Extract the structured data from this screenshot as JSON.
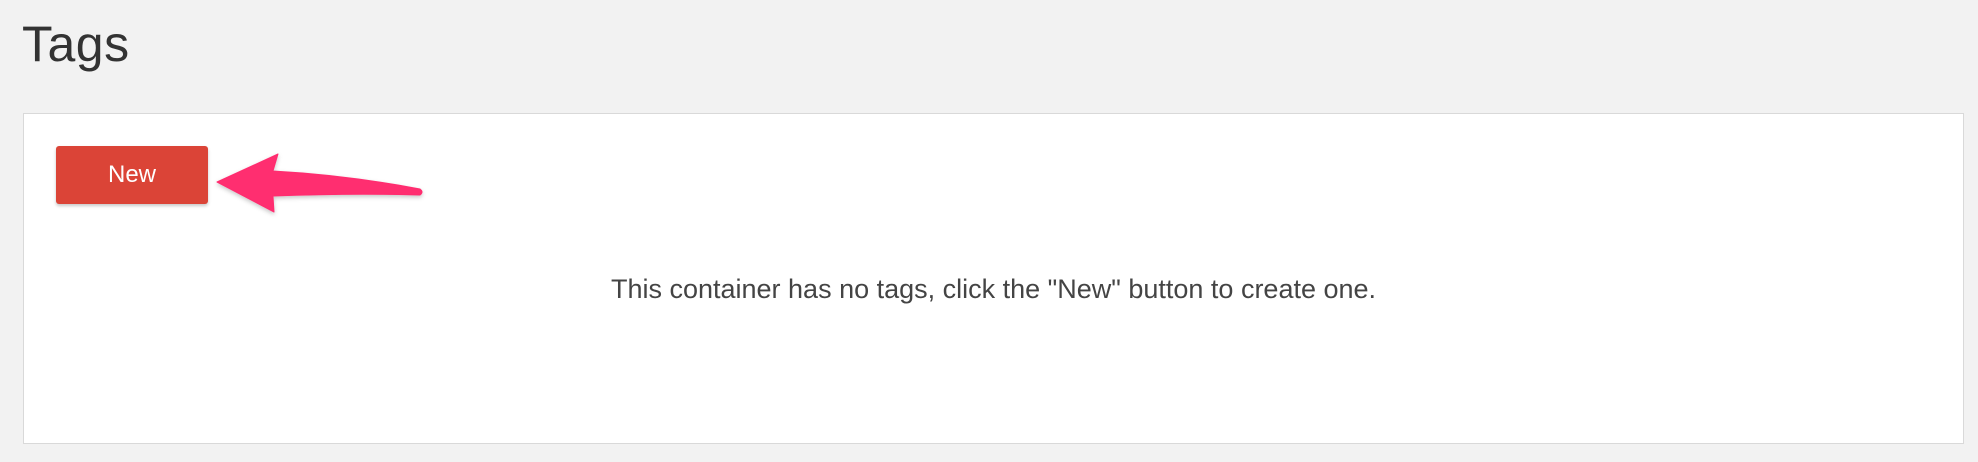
{
  "page": {
    "title": "Tags"
  },
  "panel": {
    "new_button_label": "New",
    "empty_message": "This container has no tags, click the \"New\" button to create one."
  },
  "annotation": {
    "icon": "arrow-left-icon",
    "color": "#ff2d6f"
  },
  "colors": {
    "page_background": "#f2f2f2",
    "panel_background": "#ffffff",
    "button_red": "#db4437",
    "annotation_pink": "#ff2d6f"
  }
}
